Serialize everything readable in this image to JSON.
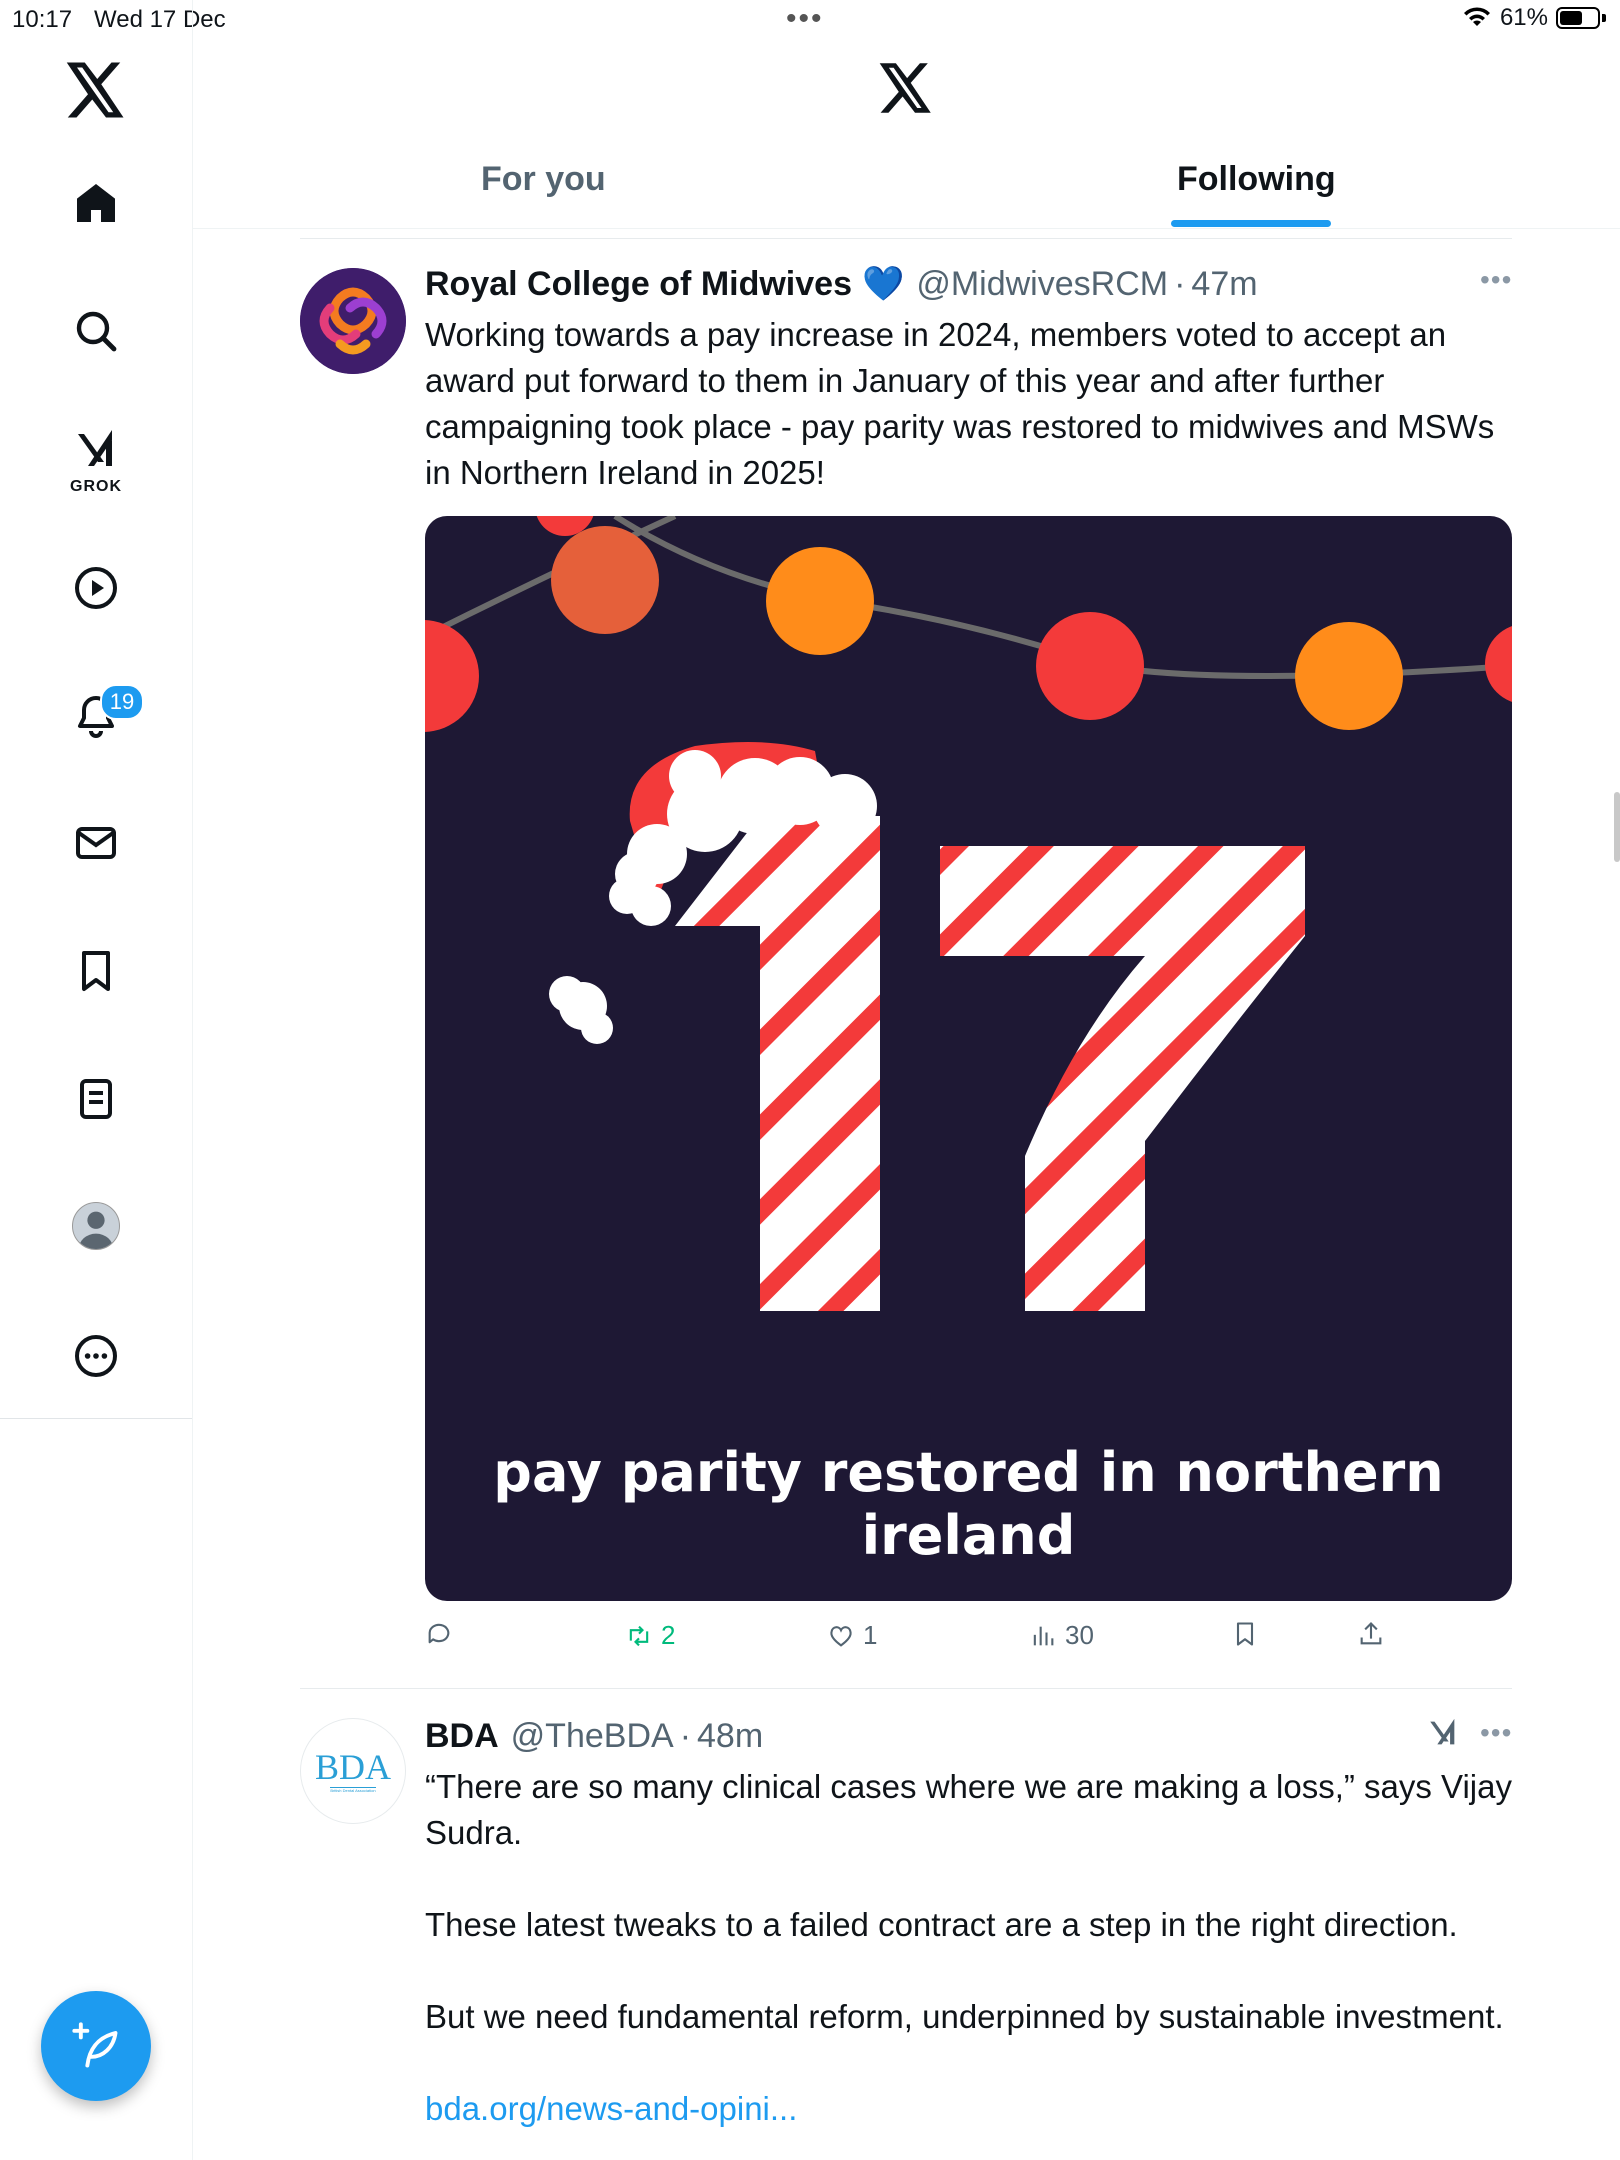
{
  "status_bar": {
    "time": "10:17",
    "date": "Wed 17 Dec",
    "battery": "61%",
    "battery_level": 0.61
  },
  "sidebar": {
    "grok_label": "GROK",
    "notification_count": "19",
    "items": [
      "home-icon",
      "search-icon",
      "grok-icon",
      "video-icon",
      "bell-icon",
      "mail-icon",
      "bookmark-icon",
      "lists-icon",
      "profile-icon",
      "more-icon"
    ]
  },
  "header": {
    "tabs": [
      {
        "label": "For you",
        "active": false
      },
      {
        "label": "Following",
        "active": true
      }
    ]
  },
  "colors": {
    "accent": "#1d9bf0",
    "media_bg": "#1e1834",
    "retweet": "#00ba7c"
  },
  "tweets": [
    {
      "name": "Royal College of Midwives",
      "badge": "💙",
      "handle": "@MidwivesRCM",
      "dot": "·",
      "time": "47m",
      "text": "Working towards a pay increase in 2024, members voted to accept an award put forward to them in January of this year and after further campaigning took place - pay parity was restored to midwives and MSWs in Northern Ireland in 2025!",
      "media": {
        "number": "17",
        "caption": "pay parity restored in northern ireland"
      },
      "actions": {
        "replies": "",
        "retweets": "2",
        "likes": "1",
        "views": "30"
      }
    },
    {
      "name": "BDA",
      "handle": "@TheBDA",
      "dot": "·",
      "time": "48m",
      "avatar_text": "BDA",
      "avatar_subtext": "British Dental Association",
      "paragraphs": [
        "“There are so many clinical cases where we are making a loss,” says Vijay Sudra.",
        "These latest tweaks to a failed contract are a step in the right direction.",
        "But we need fundamental reform, underpinned by sustainable investment."
      ],
      "link": "bda.org/news-and-opini..."
    }
  ]
}
